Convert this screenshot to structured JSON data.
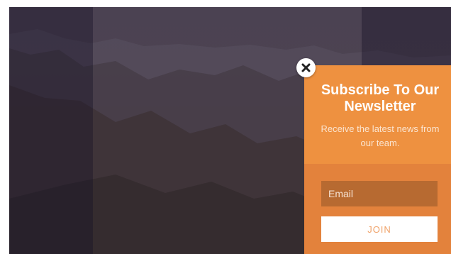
{
  "popup": {
    "title": "Subscribe To Our Newsletter",
    "subtitle": "Receive the latest news from our team.",
    "email_placeholder": "Email",
    "join_label": "JOIN",
    "close_icon": "close-icon"
  },
  "colors": {
    "popup_primary": "#ee9140",
    "popup_secondary": "#e3823c",
    "field_background": "#b76a31",
    "button_text": "#f0a36a"
  }
}
